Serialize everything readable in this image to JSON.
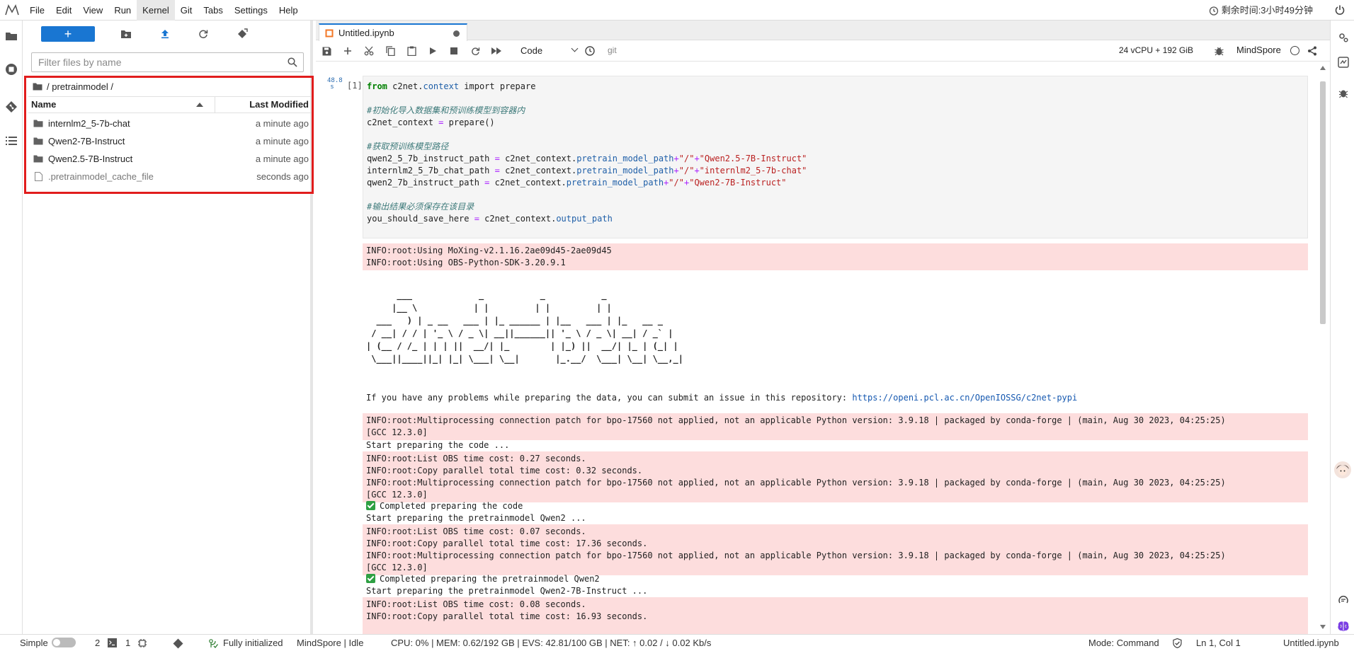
{
  "menubar": {
    "items": [
      "File",
      "Edit",
      "View",
      "Run",
      "Kernel",
      "Git",
      "Tabs",
      "Settings",
      "Help"
    ],
    "active_item": "Kernel",
    "timer_text": "剩余时间:3小时49分钟"
  },
  "filebrowser": {
    "new_label": "+",
    "search_placeholder": "Filter files by name",
    "breadcrumb": "/ pretrainmodel /",
    "columns": {
      "name": "Name",
      "modified": "Last Modified"
    },
    "files": [
      {
        "name": "internlm2_5-7b-chat",
        "modified": "a minute ago",
        "type": "folder"
      },
      {
        "name": "Qwen2-7B-Instruct",
        "modified": "a minute ago",
        "type": "folder"
      },
      {
        "name": "Qwen2.5-7B-Instruct",
        "modified": "a minute ago",
        "type": "folder"
      },
      {
        "name": ".pretrainmodel_cache_file",
        "modified": "seconds ago",
        "type": "file"
      }
    ]
  },
  "notebook": {
    "tab_title": "Untitled.ipynb",
    "cell_type": "Code",
    "git_label": "git",
    "resources": "24 vCPU + 192 GiB",
    "kernel": "MindSpore",
    "cell": {
      "exec_time": "48.8\ns",
      "prompt": "[1]",
      "code": [
        "from c2net.context import prepare",
        "",
        "#初始化导入数据集和预训练模型到容器内",
        "c2net_context = prepare()",
        "",
        "#获取预训练模型路径",
        "qwen2_5_7b_instruct_path = c2net_context.pretrain_model_path+\"/\"+\"Qwen2.5-7B-Instruct\"",
        "internlm2_5_7b_chat_path = c2net_context.pretrain_model_path+\"/\"+\"internlm2_5-7b-chat\"",
        "qwen2_7b_instruct_path = c2net_context.pretrain_model_path+\"/\"+\"Qwen2-7B-Instruct\"",
        "",
        "#输出结果必须保存在该目录",
        "you_should_save_here = c2net_context.output_path"
      ]
    },
    "outputs": {
      "info1": "INFO:root:Using MoXing-v2.1.16.2ae09d45-2ae09d45\nINFO:root:Using OBS-Python-SDK-3.20.9.1",
      "ascii_art": "      ___             _           _           _\n     |__ \\           | |         | |         | |\n  ___   ) | _ __   ___ | |_ ______ | |__   ___ | |_   __ _\n / __| / / | '_ \\ / _ \\| __||______|| '_ \\ / _ \\| __| / _` |\n| (__ / /_ | | | ||  __/| |_        | |_) ||  __/| |_ | (_| |\n \\___||____||_| |_| \\___| \\__|       |_.__/  \\___| \\__| \\__,_|",
      "problem_prefix": "If you have any problems while preparing the data, you can submit an issue in this repository: ",
      "problem_link": "https://openi.pcl.ac.cn/OpenIOSSG/c2net-pypi",
      "info2": "INFO:root:Multiprocessing connection patch for bpo-17560 not applied, not an applicable Python version: 3.9.18 | packaged by conda-forge | (main, Aug 30 2023, 04:25:25)\n[GCC 12.3.0]",
      "start_code": "Start preparing the code ...",
      "info3": "INFO:root:List OBS time cost: 0.27 seconds.\nINFO:root:Copy parallel total time cost: 0.32 seconds.\nINFO:root:Multiprocessing connection patch for bpo-17560 not applied, not an applicable Python version: 3.9.18 | packaged by conda-forge | (main, Aug 30 2023, 04:25:25)\n[GCC 12.3.0]",
      "completed_code": "Completed preparing the code",
      "start_qwen2": "Start preparing the pretrainmodel Qwen2 ...",
      "info4": "INFO:root:List OBS time cost: 0.07 seconds.\nINFO:root:Copy parallel total time cost: 17.36 seconds.\nINFO:root:Multiprocessing connection patch for bpo-17560 not applied, not an applicable Python version: 3.9.18 | packaged by conda-forge | (main, Aug 30 2023, 04:25:25)\n[GCC 12.3.0]",
      "completed_qwen2": "Completed preparing the pretrainmodel Qwen2",
      "start_qwen2_7b": "Start preparing the pretrainmodel Qwen2-7B-Instruct ...",
      "info5": "INFO:root:List OBS time cost: 0.08 seconds.\nINFO:root:Copy parallel total time cost: 16.93 seconds."
    }
  },
  "statusbar": {
    "mode_label": "Simple",
    "terminals": "2",
    "kernels": "1",
    "git_status": "Fully initialized",
    "kernel_status": "MindSpore | Idle",
    "metrics": "CPU: 0% | MEM: 0.62/192 GB | EVS: 42.81/100 GB | NET: ↑ 0.02 / ↓ 0.02 Kb/s",
    "mode": "Mode: Command",
    "cursor": "Ln 1, Col 1",
    "filename": "Untitled.ipynb"
  },
  "colors": {
    "accent": "#1976d2",
    "highlight": "#e11d1d",
    "stderr_bg": "#fddddd"
  }
}
